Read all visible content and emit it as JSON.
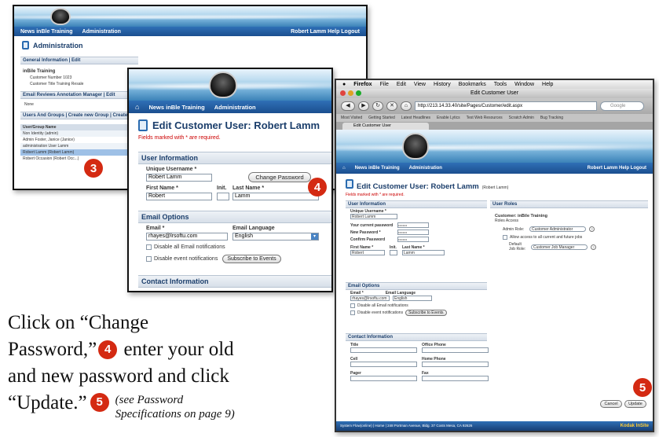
{
  "shot1": {
    "nav": [
      "News inBle Training",
      "Administration"
    ],
    "nav_right": "Robert Lamm  Help  Logout",
    "title": "Administration",
    "rows": [
      "General Information  |  Edit",
      "inBile Training",
      "Customer Number   1023",
      "Customer Title   Training Resale",
      "Email Reviews Annotation Manager  |  Edit",
      "None",
      "Users And Groups  |  Create new Group  |  Create",
      "User/Group Name",
      "Non Identity (admin)",
      "Admin Foster, Janice (Janice)",
      "administration User Lamm",
      "Robert Lamm (Robert Lamm)",
      "Robert Occasion (Robert Occ...)"
    ]
  },
  "shot2": {
    "nav": [
      "News inBle Training",
      "Administration"
    ],
    "title": "Edit Customer User: Robert Lamm",
    "required_note": "Fields marked with * are required.",
    "section_user": "User Information",
    "label_username": "Unique Username  *",
    "value_username": "Robert Lamm",
    "change_password": "Change Password",
    "label_first": "First Name  *",
    "value_first": "Robert",
    "label_init": "Init.",
    "label_last": "Last Name  *",
    "value_last": "Lamm",
    "section_email": "Email Options",
    "label_email": "Email  *",
    "value_email": "rhayes@lrsoftu.com",
    "label_lang": "Email Language",
    "value_lang": "English",
    "check_disable": "Disable all Email notifications",
    "check_event": "Disable event notifications",
    "subscribe": "Subscribe to Events",
    "section_contact": "Contact Information"
  },
  "shot3": {
    "menubar": [
      "Firefox",
      "File",
      "Edit",
      "View",
      "History",
      "Bookmarks",
      "Tools",
      "Window",
      "Help"
    ],
    "window_title": "Edit Customer User",
    "url": "http://213.14.33.40/site/Pages/Customer/edit.aspx",
    "search_placeholder": "Google",
    "bookmarks": [
      "Most Visited",
      "Getting Started",
      "Latest Headlines",
      "Enable Lytics",
      "Test Web Resources",
      "Scratch Admin",
      "Bug Tracking"
    ],
    "tab": "Edit Customer User",
    "nav": [
      "News inBle Training",
      "Administration"
    ],
    "nav_right": "Robert Lamm  Help  Logout",
    "title": "Edit Customer User: Robert Lamm",
    "title_sub": "(Robert Lamm)",
    "required_note": "Fields marked with * are required.",
    "section_user": "User Information",
    "section_roles": "User Roles",
    "label_username": "Unique Username  *",
    "value_username": "Robert Lamm",
    "label_current_pw": "Your current password",
    "label_new_pw": "New Password  *",
    "label_confirm_pw": "Confirm Password",
    "pw_mask": "••••••••",
    "label_first": "First Name  *",
    "value_first": "Robert",
    "label_init": "Init.",
    "label_last": "Last Name  *",
    "value_last": "Lamm",
    "roles_title": "Customer: inBile Training",
    "roles_sub": "Roles Access",
    "role_admin_label": "Admin Role:",
    "role_admin_value": "Customer Administrator",
    "role_allow": "Allow access to all current and future jobs",
    "role_default_label": "Default Job Role:",
    "role_default_value": "Customer Job Manager",
    "section_email": "Email Options",
    "label_email": "Email  *",
    "value_email": "rhayes@lrsoftu.com",
    "label_lang": "Email Language",
    "value_lang": "English",
    "check_disable": "Disable all Email notifications",
    "check_event": "Disable event notifications",
    "subscribe": "Subscribe to Events",
    "section_contact": "Contact Information",
    "contact_fields": [
      "Title",
      "Office Phone",
      "Cell",
      "Home Phone",
      "Pager",
      "Fax"
    ],
    "cancel": "Cancel",
    "update": "Update",
    "footer": "System Flow(online)  |  Home  |  248 Portman Avenue, Bldg. 37 Costs Mesa, CA 92626",
    "footer_brand": "Kodak InSite"
  },
  "badges": {
    "b3": "3",
    "b4": "4",
    "b5a": "5",
    "b5b": "5"
  },
  "caption": {
    "line1": "Click on “Change",
    "line2a": "Password,”",
    "line2b": " enter your old",
    "line3": "and new password and click",
    "line4": "“Update.”",
    "note1": "(see Password",
    "note2": "Specifications on page 9)"
  },
  "colors": {
    "badge": "#d42a12",
    "nav": "#1b4f8f",
    "required": "#cc0000"
  }
}
